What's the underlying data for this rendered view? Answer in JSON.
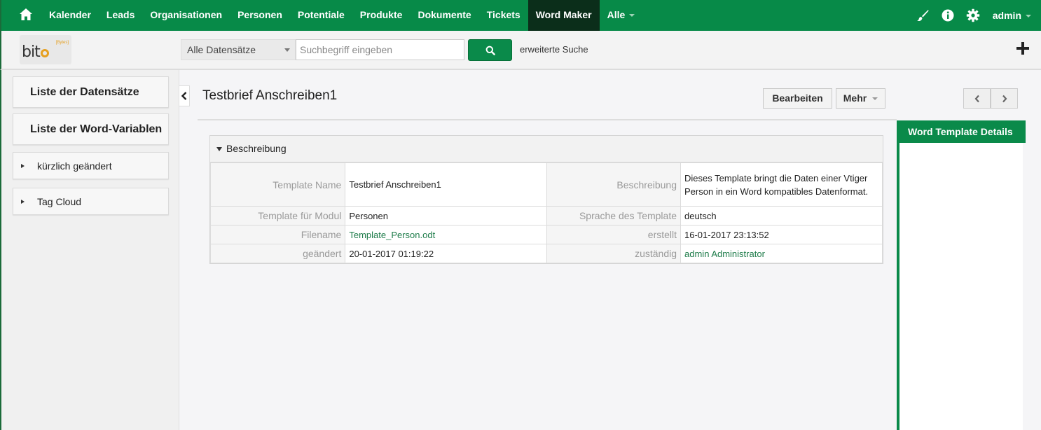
{
  "nav": {
    "items": [
      "Kalender",
      "Leads",
      "Organisationen",
      "Personen",
      "Potentiale",
      "Produkte",
      "Dokumente",
      "Tickets",
      "Word Maker",
      "Alle"
    ],
    "active": "Word Maker",
    "user": "admin",
    "icons": [
      "home-icon",
      "brush-icon",
      "info-icon",
      "gear-icon"
    ]
  },
  "search": {
    "scope": "Alle Datensätze",
    "placeholder": "Suchbegriff eingeben",
    "value": "",
    "advanced_label": "erweiterte Suche"
  },
  "logo": {
    "text": "bit",
    "tag": "[Bytes]"
  },
  "sidebar": {
    "list_records": "Liste der Datensätze",
    "list_vars": "Liste der Word-Variablen",
    "recent": "kürzlich geändert",
    "tagcloud": "Tag Cloud"
  },
  "record": {
    "title": "Testbrief Anschreiben1",
    "edit_label": "Bearbeiten",
    "more_label": "Mehr"
  },
  "block": {
    "title": "Beschreibung",
    "rows": [
      {
        "l1": "Template Name",
        "v1": "Testbrief Anschreiben1",
        "l2": "Beschreibung",
        "v2": "Dieses Template bringt die Daten einer Vtiger Person in ein Word kompatibles Datenformat."
      },
      {
        "l1": "Template für Modul",
        "v1": "Personen",
        "l2": "Sprache des Template",
        "v2": "deutsch"
      },
      {
        "l1": "Filename",
        "v1": "Template_Person.odt",
        "l2": "erstellt",
        "v2": "16-01-2017 23:13:52"
      },
      {
        "l1": "geändert",
        "v1": "20-01-2017 01:19:22",
        "l2": "zuständig",
        "v2": "admin Administrator"
      }
    ]
  },
  "right_panel": {
    "title": "Word Template Details"
  },
  "colors": {
    "primary": "#0a8a4a",
    "active_nav": "#0b2e1a",
    "link": "#1e7c4a"
  }
}
